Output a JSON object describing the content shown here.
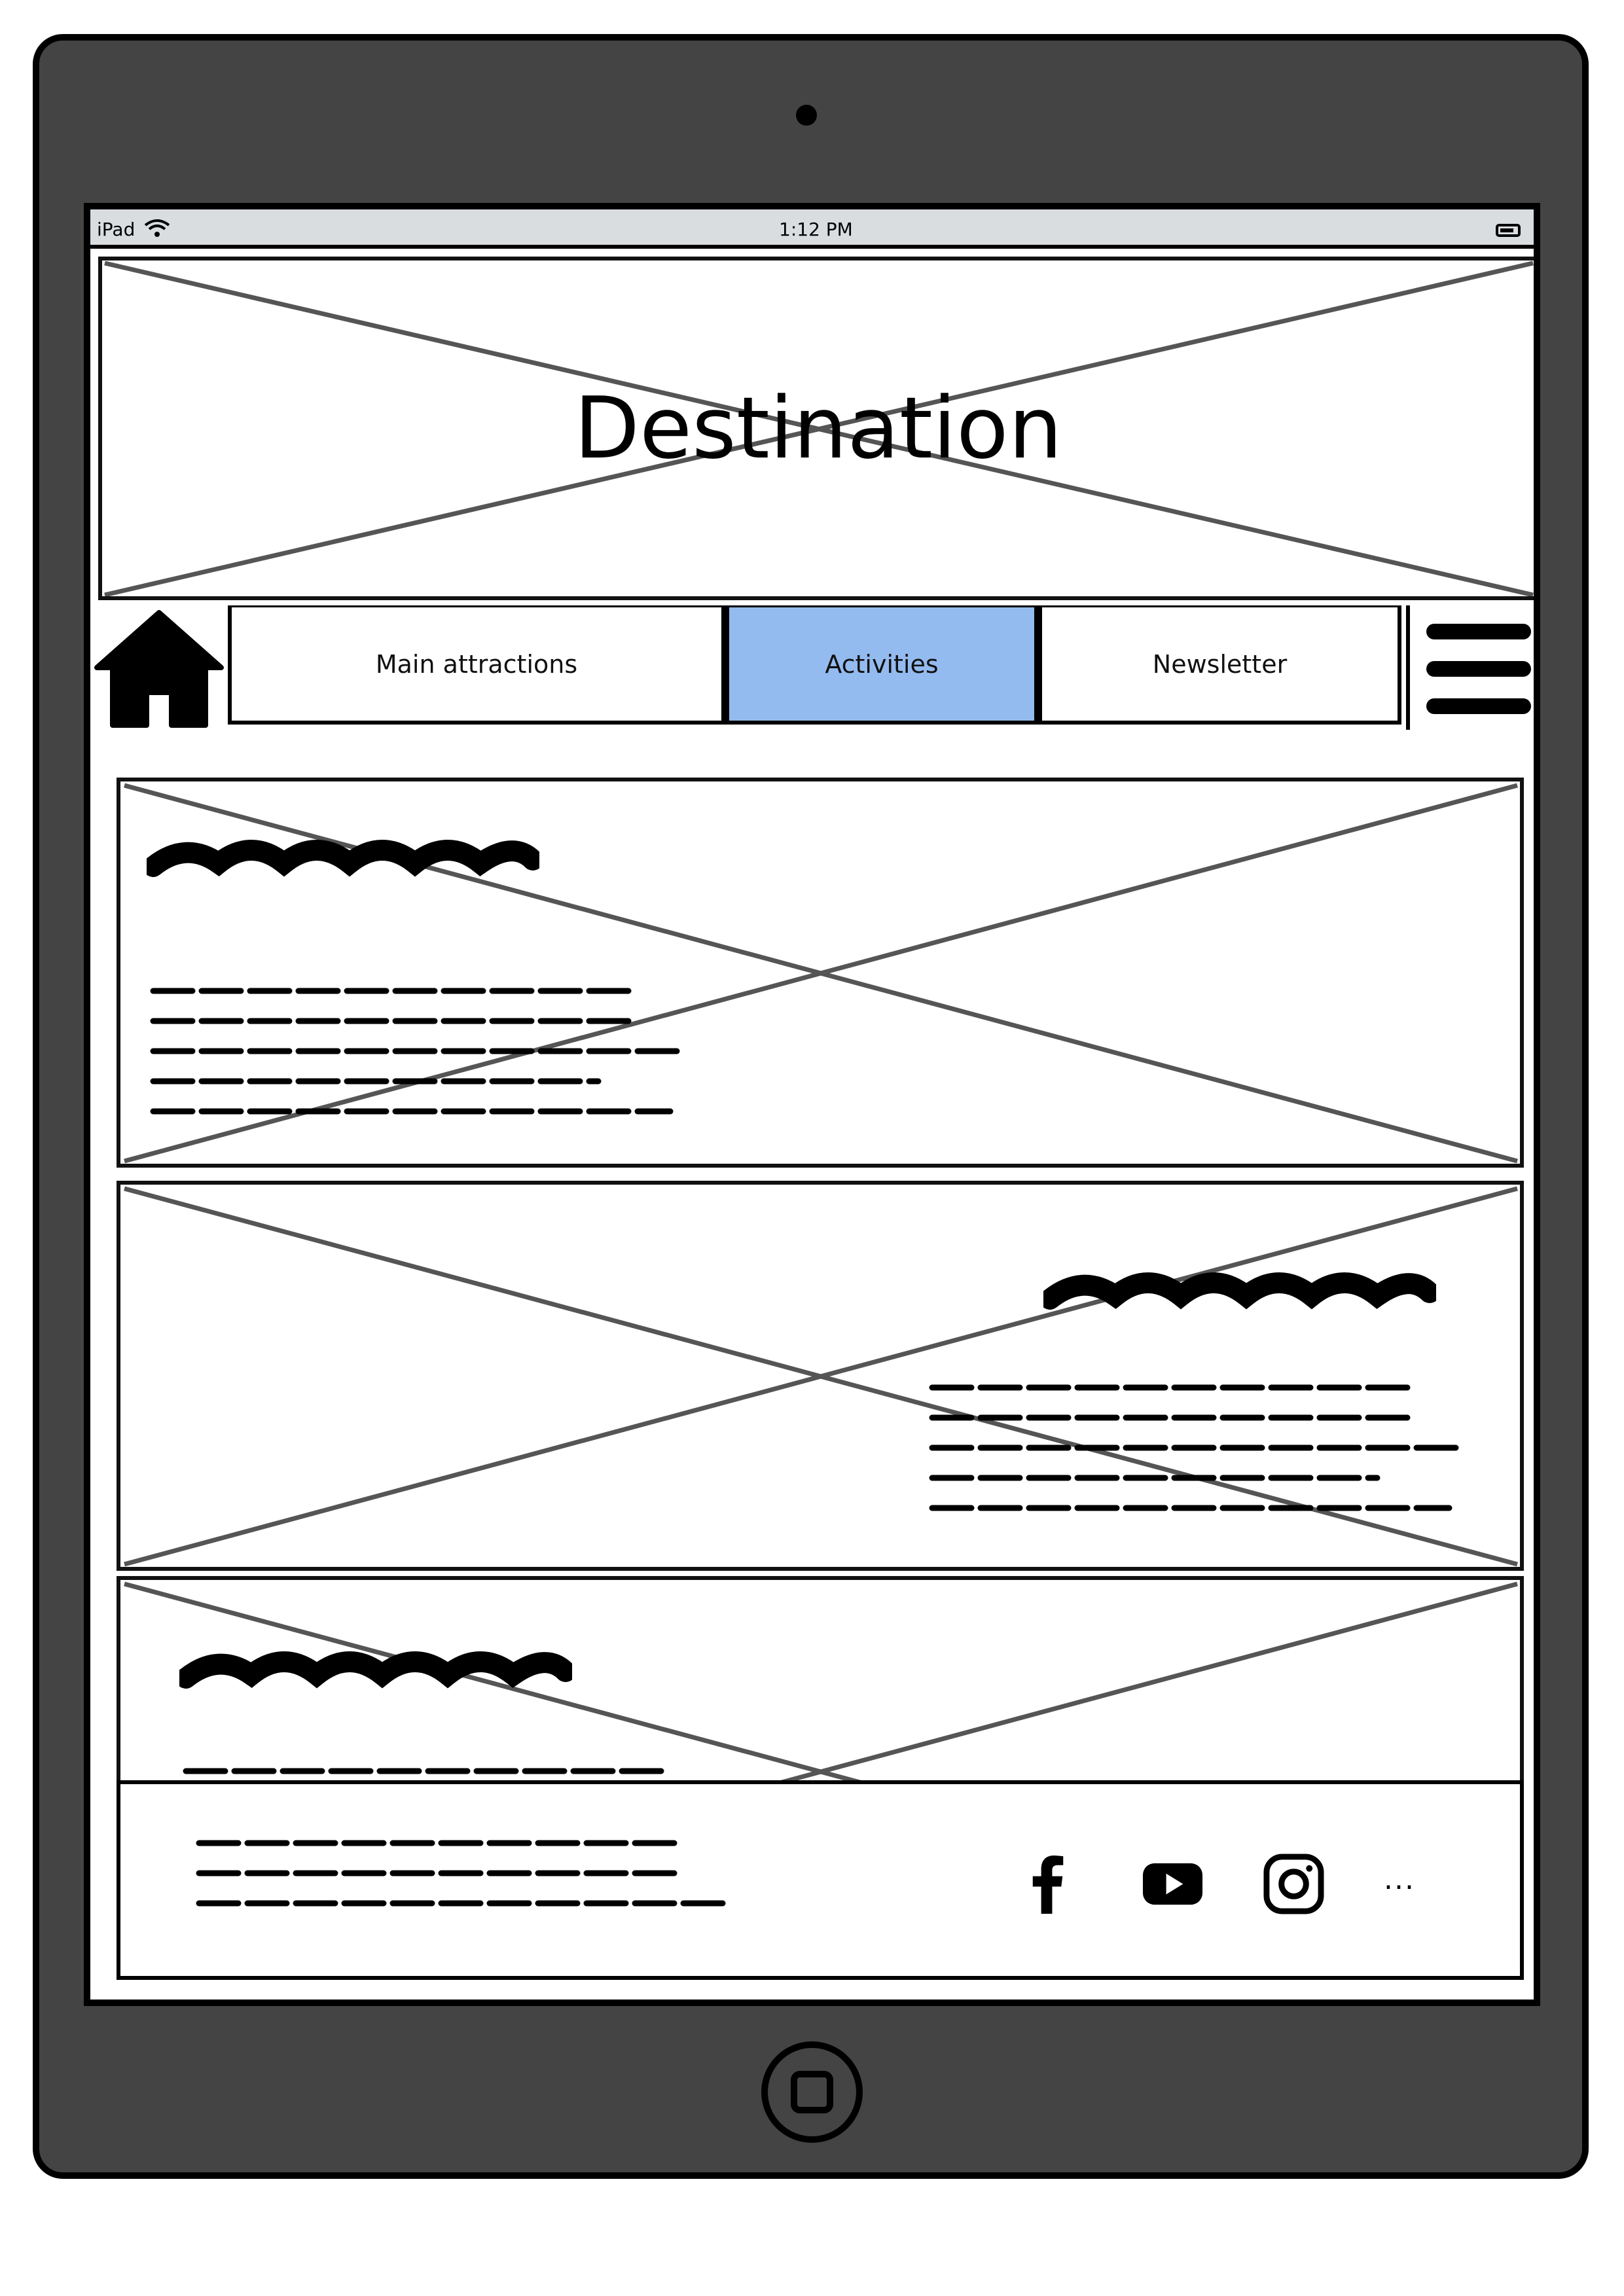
{
  "device": {
    "model": "iPad",
    "time": "1:12 PM"
  },
  "banner": {
    "title": "Destination"
  },
  "nav": {
    "tabs": [
      {
        "label": "Main attractions",
        "active": false
      },
      {
        "label": "Activities",
        "active": true
      },
      {
        "label": "Newsletter",
        "active": false
      }
    ],
    "active_color": "#94bbef"
  },
  "cards": [
    {
      "layout": "text-left"
    },
    {
      "layout": "text-right"
    },
    {
      "layout": "text-left"
    }
  ],
  "footer": {
    "social_icons": [
      "facebook-icon",
      "youtube-icon",
      "instagram-icon",
      "more-icon"
    ],
    "more_label": "..."
  },
  "colors": {
    "device": "#444444",
    "statusbar": "#d9dde0"
  }
}
